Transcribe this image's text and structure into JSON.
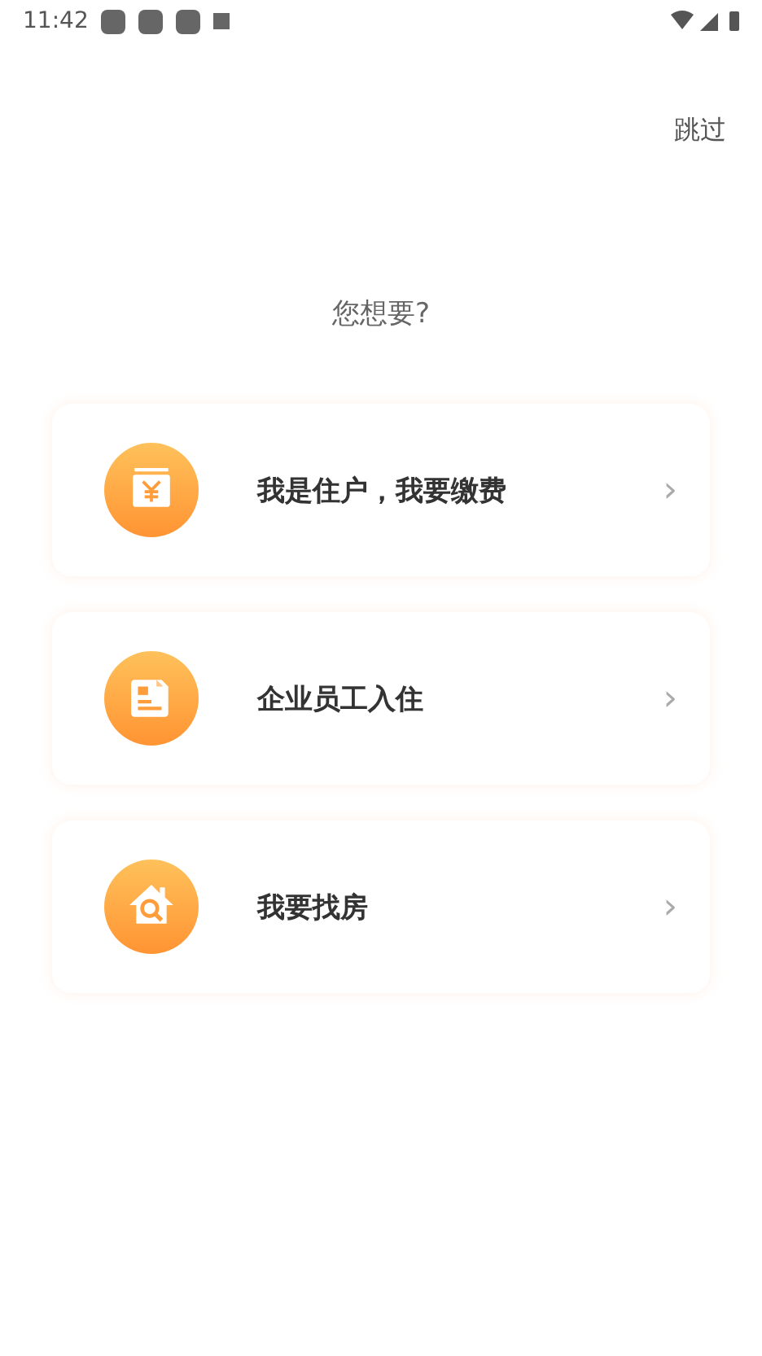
{
  "status_bar": {
    "time": "11:42"
  },
  "skip": "跳过",
  "question": "您想要?",
  "options": [
    {
      "kind": "payment",
      "label": "我是住户，我要缴费",
      "chevron": "›"
    },
    {
      "kind": "document",
      "label": "企业员工入住",
      "chevron": "›"
    },
    {
      "kind": "house",
      "label": "我要找房",
      "chevron": "›"
    }
  ]
}
